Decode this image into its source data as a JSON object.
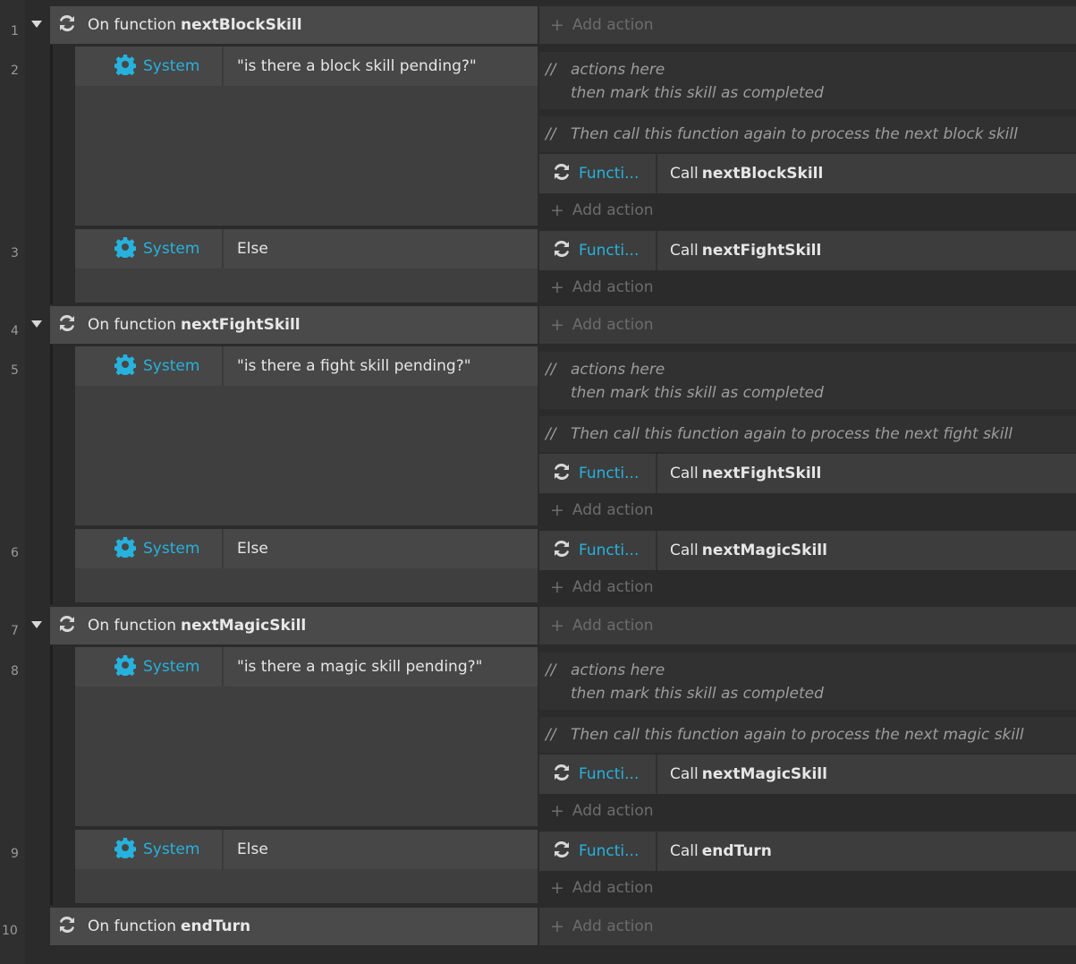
{
  "line_numbers": [
    "1",
    "2",
    "3",
    "4",
    "5",
    "6",
    "7",
    "8",
    "9",
    "10"
  ],
  "add_action_label": "Add action",
  "events": [
    {
      "prefix": "On function",
      "name": "nextBlockSkill"
    },
    {
      "prefix": "On function",
      "name": "nextFightSkill"
    },
    {
      "prefix": "On function",
      "name": "nextMagicSkill"
    },
    {
      "prefix": "On function",
      "name": "endTurn"
    }
  ],
  "subevents": [
    {
      "object": "System",
      "condition": "\"is there a block skill pending?\"",
      "comment1": {
        "line1": "actions here",
        "line2": "then mark this skill as completed"
      },
      "comment2": "Then call this function again to process the next block skill",
      "action": {
        "object": "Functi...",
        "verb": "Call",
        "target": "nextBlockSkill"
      }
    },
    {
      "object": "System",
      "condition": "Else",
      "action": {
        "object": "Functi...",
        "verb": "Call",
        "target": "nextFightSkill"
      }
    },
    {
      "object": "System",
      "condition": "\"is there a fight skill pending?\"",
      "comment1": {
        "line1": "actions here",
        "line2": "then mark this skill as completed"
      },
      "comment2": "Then call this function again to process the next fight skill",
      "action": {
        "object": "Functi...",
        "verb": "Call",
        "target": "nextFightSkill"
      }
    },
    {
      "object": "System",
      "condition": "Else",
      "action": {
        "object": "Functi...",
        "verb": "Call",
        "target": "nextMagicSkill"
      }
    },
    {
      "object": "System",
      "condition": "\"is there a magic skill pending?\"",
      "comment1": {
        "line1": "actions here",
        "line2": "then mark this skill as completed"
      },
      "comment2": "Then call this function again to process the next magic skill",
      "action": {
        "object": "Functi...",
        "verb": "Call",
        "target": "nextMagicSkill"
      }
    },
    {
      "object": "System",
      "condition": "Else",
      "action": {
        "object": "Functi...",
        "verb": "Call",
        "target": "endTurn"
      }
    }
  ],
  "comment_marker": "//",
  "icons": {
    "event": "function-loop-icon",
    "system": "gear-icon",
    "add": "plus-icon",
    "expand": "collapse-triangle-icon"
  },
  "colors": {
    "accent": "#27b2dd",
    "event_bg": "#4a4a4a",
    "background": "#2b2b2b"
  }
}
